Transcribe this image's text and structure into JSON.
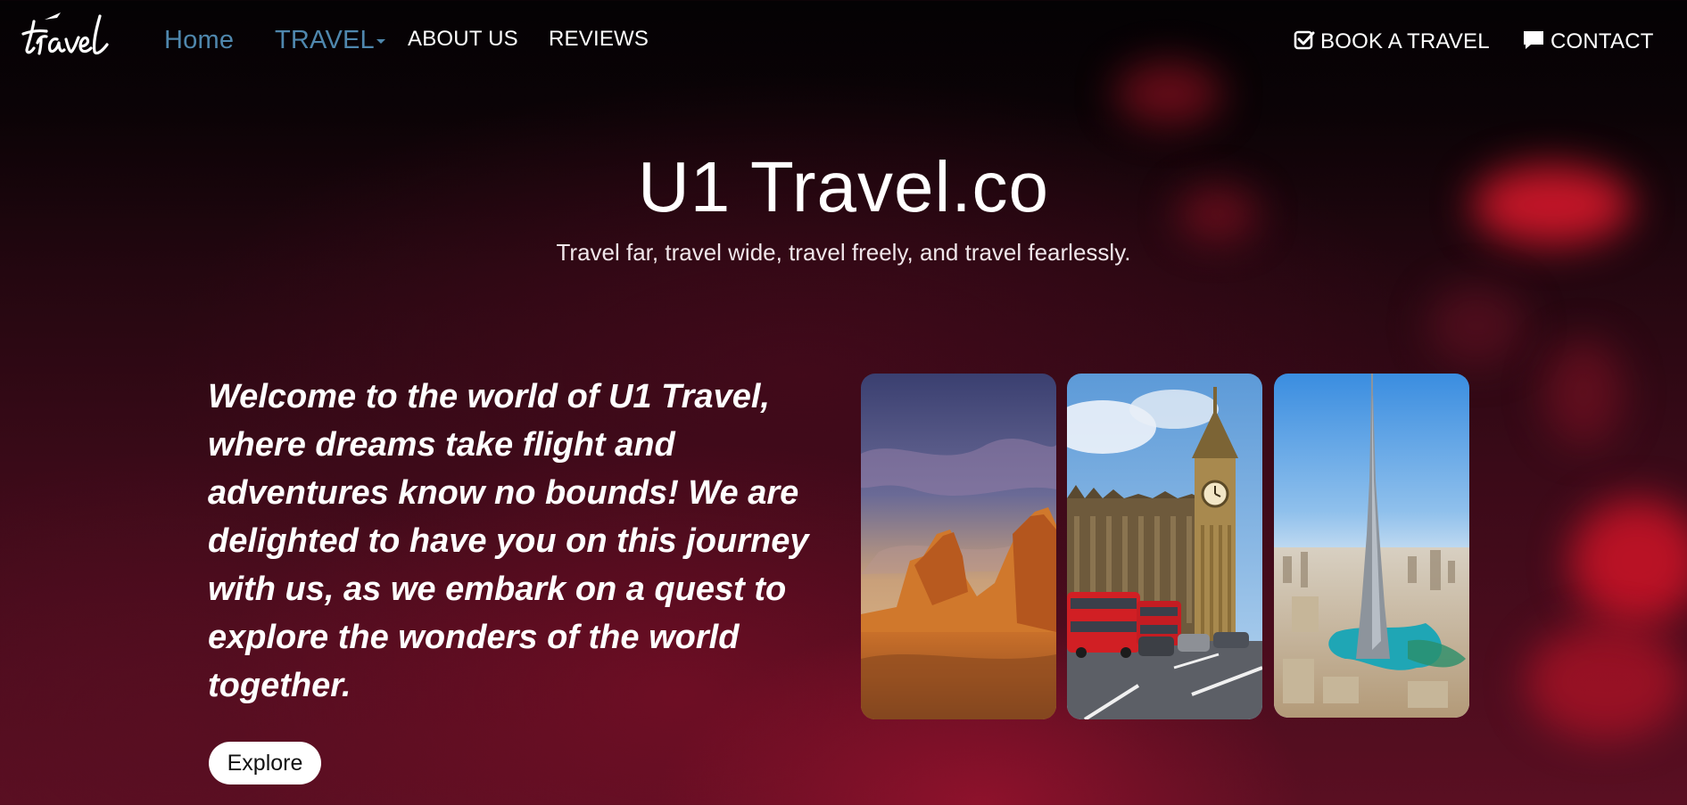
{
  "nav": {
    "logo_text": "travel",
    "links": [
      {
        "label": "Home",
        "active": true
      },
      {
        "label": "TRAVEL",
        "dropdown": true
      },
      {
        "label": "ABOUT US"
      },
      {
        "label": "REVIEWS"
      }
    ],
    "book_label": "BOOK A TRAVEL",
    "contact_label": "CONTACT",
    "book_icon": "check-square-icon",
    "contact_icon": "chat-bubble-icon"
  },
  "hero": {
    "title": "U1 Travel.co",
    "tagline": "Travel far, travel wide, travel freely, and travel fearlessly."
  },
  "welcome": {
    "text": "Welcome to the world of U1 Travel, where dreams take flight and adventures know no bounds! We are delighted to have you on this journey with us, as we embark on a quest to explore the wonders of the world together.",
    "button_label": "Explore"
  },
  "gallery": [
    {
      "subject": "desert-rock-formation"
    },
    {
      "subject": "big-ben-london-red-buses"
    },
    {
      "subject": "burj-khalifa-dubai"
    }
  ],
  "colors": {
    "nav_active": "#4f87ad",
    "background_dark": "#040204",
    "background_crimson": "#5a0f22"
  }
}
